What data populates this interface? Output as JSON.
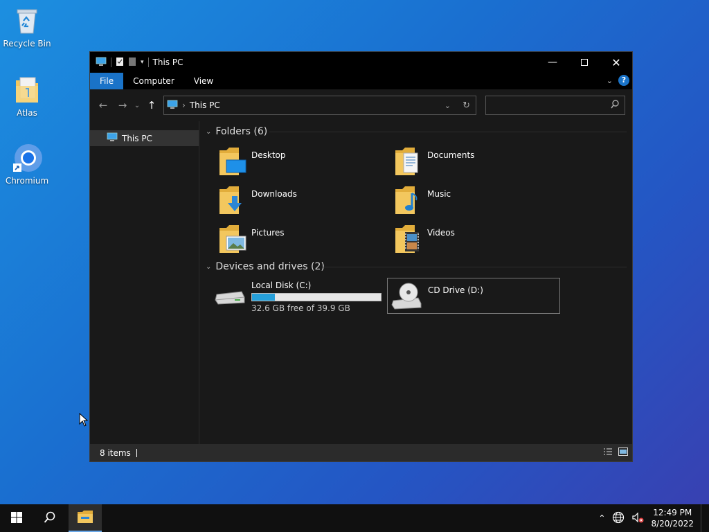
{
  "desktop": {
    "icons": [
      {
        "label": "Recycle Bin"
      },
      {
        "label": "Atlas"
      },
      {
        "label": "Chromium"
      }
    ]
  },
  "window": {
    "title": "This PC",
    "ribbon": {
      "tabs": [
        "File",
        "Computer",
        "View"
      ],
      "help": "?"
    },
    "address": {
      "path": "This PC",
      "separator": "›"
    },
    "search": {
      "placeholder": ""
    },
    "nav_pane": {
      "items": [
        "This PC"
      ]
    },
    "groups": {
      "folders": {
        "title": "Folders (6)",
        "items": [
          "Desktop",
          "Documents",
          "Downloads",
          "Music",
          "Pictures",
          "Videos"
        ]
      },
      "drives": {
        "title": "Devices and drives (2)",
        "items": [
          {
            "name": "Local Disk (C:)",
            "free_text": "32.6 GB free of 39.9 GB",
            "used_fraction": 0.18
          },
          {
            "name": "CD Drive (D:)"
          }
        ]
      }
    },
    "status": {
      "items": "8 items"
    }
  },
  "taskbar": {
    "time": "12:49 PM",
    "date": "8/20/2022"
  },
  "colors": {
    "accent": "#1a73c8",
    "folder": "#f3c75e",
    "drive_fill": "#26a0da"
  }
}
